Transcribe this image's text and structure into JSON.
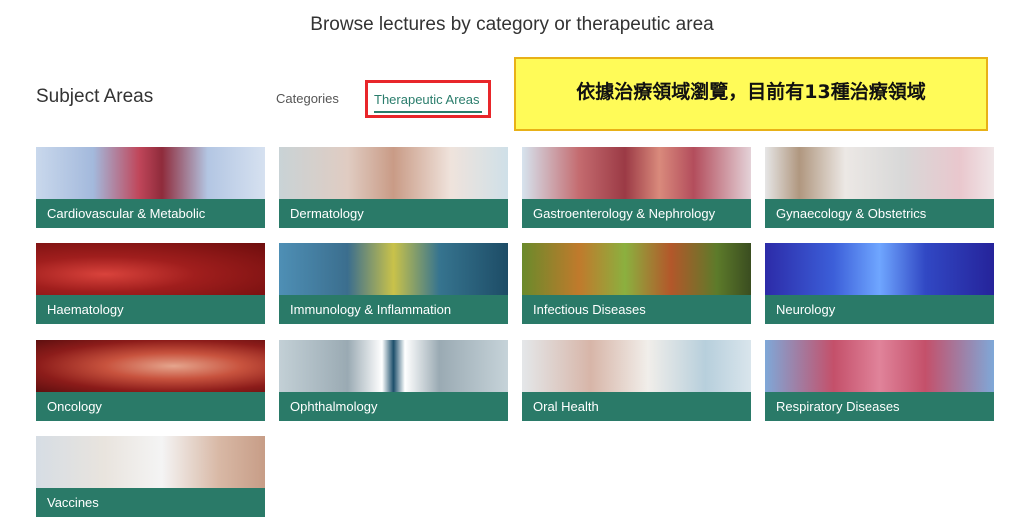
{
  "headline": "Browse lectures by category or therapeutic area",
  "subject_areas_title": "Subject Areas",
  "tabs": {
    "categories": "Categories",
    "therapeutic": "Therapeutic Areas"
  },
  "annotation": "依據治療領域瀏覽，目前有13種治療領域",
  "areas": [
    {
      "label": "Cardiovascular & Metabolic"
    },
    {
      "label": "Dermatology"
    },
    {
      "label": "Gastroenterology & Nephrology"
    },
    {
      "label": "Gynaecology & Obstetrics"
    },
    {
      "label": "Haematology"
    },
    {
      "label": "Immunology & Inflammation"
    },
    {
      "label": "Infectious Diseases"
    },
    {
      "label": "Neurology"
    },
    {
      "label": "Oncology"
    },
    {
      "label": "Ophthalmology"
    },
    {
      "label": "Oral Health"
    },
    {
      "label": "Respiratory Diseases"
    },
    {
      "label": "Vaccines"
    }
  ],
  "colors": {
    "card_bar": "#2a7a68",
    "active_tab": "#2a7d6c",
    "highlight_border": "#e8262a",
    "annotation_bg": "#fffb58"
  }
}
